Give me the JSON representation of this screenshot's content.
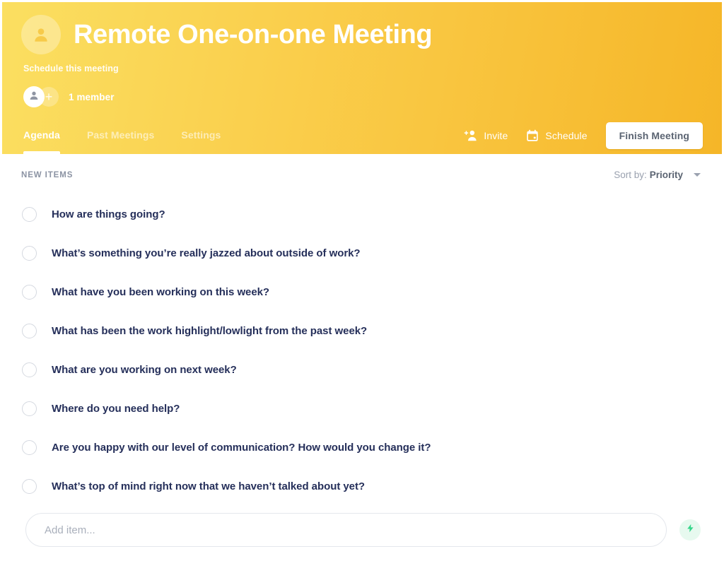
{
  "header": {
    "title": "Remote One-on-one Meeting",
    "subtitle": "Schedule this meeting",
    "member_count": "1 member",
    "avatar_icon": "person-icon",
    "member_avatar_icon": "person-icon",
    "add_member_icon": "plus-icon",
    "gradient_from": "#fbdf61",
    "gradient_to": "#f5b628"
  },
  "tabs": [
    {
      "label": "Agenda",
      "active": true
    },
    {
      "label": "Past Meetings",
      "active": false
    },
    {
      "label": "Settings",
      "active": false
    }
  ],
  "actions": {
    "invite_label": "Invite",
    "invite_icon": "add-person-icon",
    "schedule_label": "Schedule",
    "schedule_icon": "calendar-icon",
    "finish_label": "Finish Meeting"
  },
  "list": {
    "section_label": "NEW ITEMS",
    "sort_label": "Sort by:",
    "sort_value": "Priority",
    "sort_caret_icon": "chevron-down-icon",
    "items": [
      {
        "text": "How are things going?",
        "checked": false
      },
      {
        "text": "What’s something you’re really jazzed about outside of work?",
        "checked": false
      },
      {
        "text": "What have you been working on this week?",
        "checked": false
      },
      {
        "text": "What has been the work highlight/lowlight from the past week?",
        "checked": false
      },
      {
        "text": "What are you working on next week?",
        "checked": false
      },
      {
        "text": "Where do you need help?",
        "checked": false
      },
      {
        "text": "Are you happy with our level of communication? How would you change it?",
        "checked": false
      },
      {
        "text": "What’s top of mind right now that we haven’t talked about yet?",
        "checked": false
      }
    ]
  },
  "add_item": {
    "value": "",
    "placeholder": "Add item...",
    "bolt_icon": "lightning-bolt-icon",
    "bolt_color": "#35d68a"
  }
}
